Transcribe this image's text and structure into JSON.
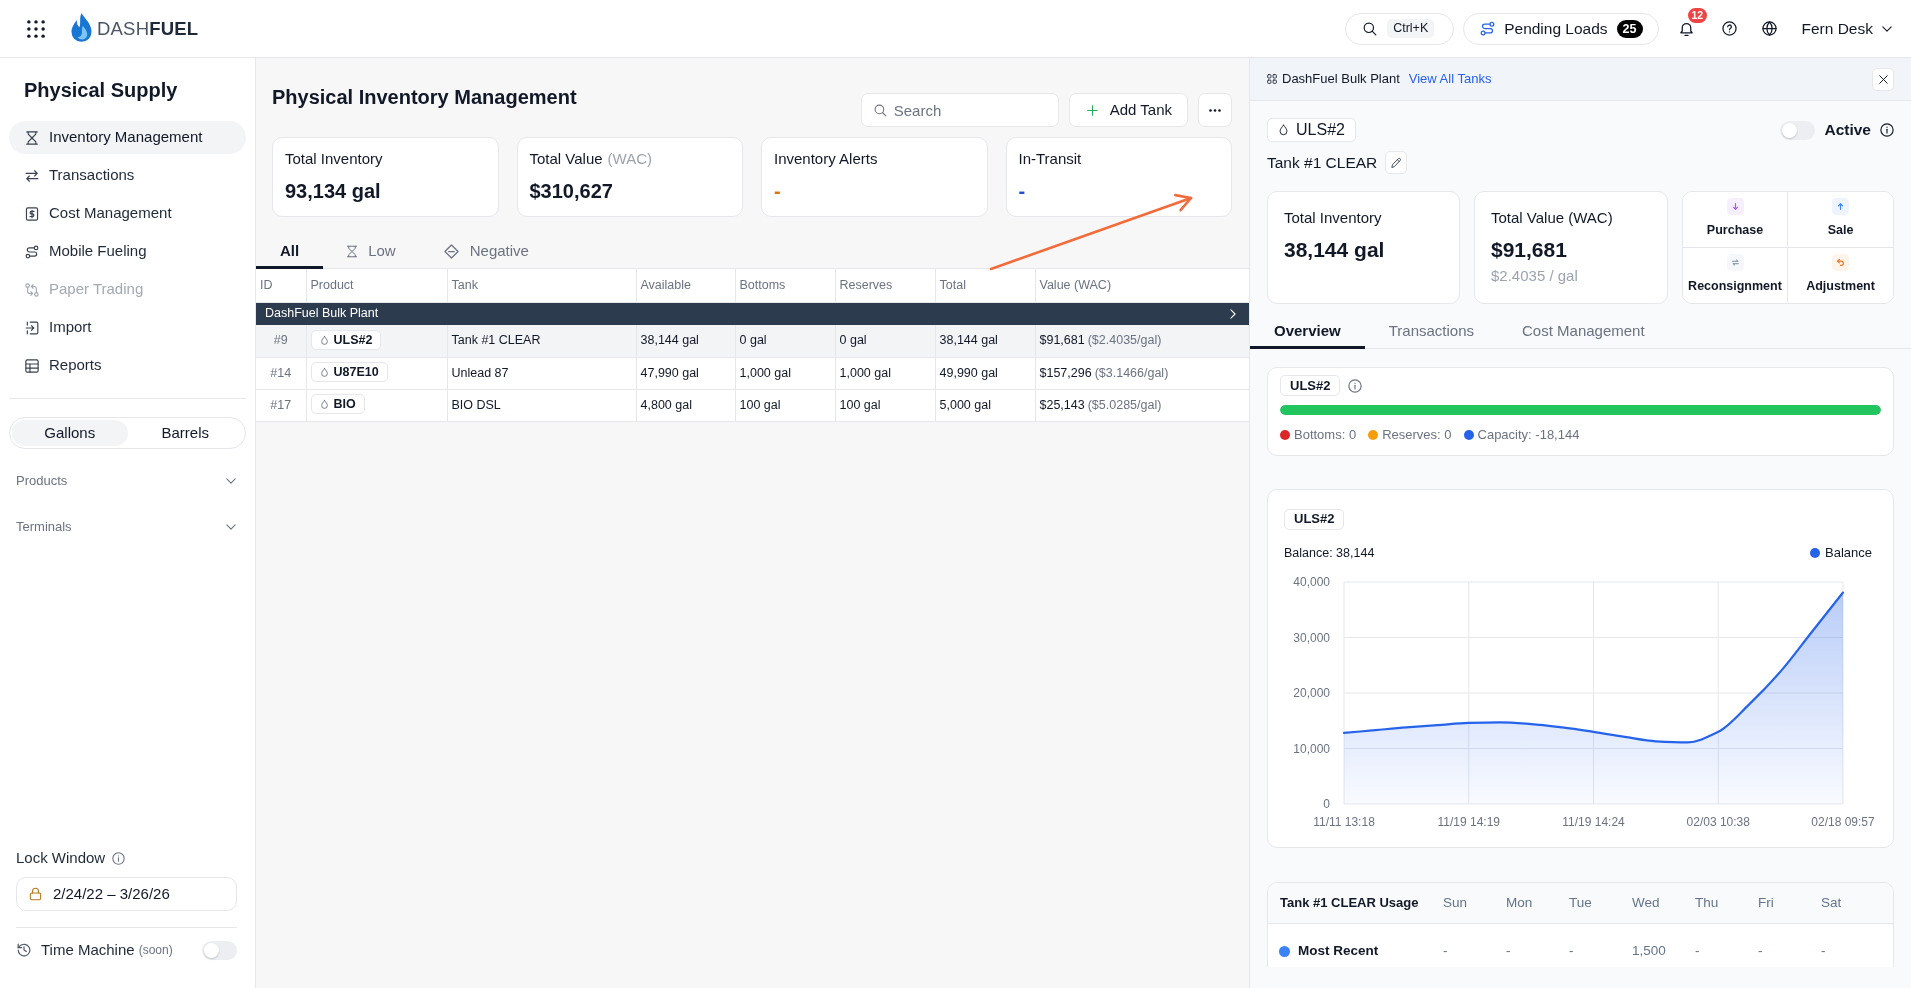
{
  "topbar": {
    "logo": "DASH**FUEL**",
    "search_shortcut": "Ctrl+K",
    "pending_loads": {
      "label": "Pending Loads",
      "count": "25"
    },
    "notifications": {
      "count": "12"
    },
    "user": "Fern Desk"
  },
  "sidebar": {
    "title": "Physical Supply",
    "items": [
      {
        "label": "Inventory Management",
        "selected": true,
        "disabled": false
      },
      {
        "label": "Transactions",
        "selected": false,
        "disabled": false
      },
      {
        "label": "Cost Management",
        "selected": false,
        "disabled": false
      },
      {
        "label": "Mobile Fueling",
        "selected": false,
        "disabled": false
      },
      {
        "label": "Paper Trading",
        "selected": false,
        "disabled": true
      },
      {
        "label": "Import",
        "selected": false,
        "disabled": false
      },
      {
        "label": "Reports",
        "selected": false,
        "disabled": false
      }
    ],
    "units": [
      {
        "label": "Gallons",
        "selected": true
      },
      {
        "label": "Barrels",
        "selected": false
      }
    ],
    "filters": [
      {
        "label": "Products",
        "expanded": false
      },
      {
        "label": "Terminals",
        "expanded": false
      }
    ],
    "lock_window": {
      "label": "Lock Window",
      "value": "2/24/22 – 3/26/26"
    },
    "time_machine": {
      "label": "Time Machine",
      "note": "(soon)",
      "on": false
    }
  },
  "main": {
    "title": "Physical Inventory Management",
    "search": {
      "placeholder": "Search"
    },
    "add_button": "Add Tank",
    "stats": [
      {
        "label": "Total Inventory",
        "value": "93,134 gal",
        "color": "#111827"
      },
      {
        "label": "Total Value",
        "note": "(WAC)",
        "value": "$310,627",
        "color": "#111827"
      },
      {
        "label": "Inventory Alerts",
        "value": "-",
        "color": "#d97706"
      },
      {
        "label": "In-Transit",
        "value": "-",
        "color": "#1d4ed8"
      }
    ],
    "tabs": [
      {
        "label": "All",
        "selected": true
      },
      {
        "label": "Low",
        "selected": false
      },
      {
        "label": "Negative",
        "selected": false
      }
    ],
    "table": {
      "columns": [
        "ID",
        "Product",
        "Tank",
        "Available",
        "Bottoms",
        "Reserves",
        "Total",
        "Value (WAC)"
      ],
      "groups": [
        {
          "name": "DashFuel Bulk Plant",
          "rows": [
            {
              "id": "#9",
              "product": "ULS#2",
              "tank": "Tank #1 CLEAR",
              "available": "38,144 gal",
              "bottoms": "0 gal",
              "reserves": "0 gal",
              "total": "38,144 gal",
              "value": "$91,681",
              "value_rate": "($2.4035/gal)",
              "selected": true
            },
            {
              "id": "#14",
              "product": "U87E10",
              "tank": "Unlead 87",
              "available": "47,990 gal",
              "bottoms": "1,000 gal",
              "reserves": "1,000 gal",
              "total": "49,990 gal",
              "value": "$157,296",
              "value_rate": "($3.1466/gal)",
              "selected": false
            },
            {
              "id": "#17",
              "product": "BIO",
              "tank": "BIO DSL",
              "available": "4,800 gal",
              "bottoms": "100 gal",
              "reserves": "100 gal",
              "total": "5,000 gal",
              "value": "$25,143",
              "value_rate": "($5.0285/gal)",
              "selected": false
            }
          ]
        }
      ]
    }
  },
  "detail": {
    "header": {
      "title": "DashFuel Bulk Plant",
      "link": "View All Tanks"
    },
    "product": "ULS#2",
    "active": {
      "label": "Active",
      "on": false
    },
    "tank": "Tank #1 CLEAR",
    "stats": [
      {
        "label": "Total Inventory",
        "value": "38,144 gal"
      },
      {
        "label": "Total Value (WAC)",
        "value": "$91,681",
        "sub": "$2.4035 / gal"
      }
    ],
    "actions": [
      "Purchase",
      "Sale",
      "Reconsignment",
      "Adjustment"
    ],
    "tabs": [
      {
        "label": "Overview",
        "selected": true
      },
      {
        "label": "Transactions",
        "selected": false
      },
      {
        "label": "Cost Management",
        "selected": false
      }
    ],
    "capacity": {
      "product": "ULS#2",
      "level": 1,
      "legend": [
        {
          "label": "Bottoms: 0",
          "color": "#dc2626"
        },
        {
          "label": "Reserves: 0",
          "color": "#f59e0b"
        },
        {
          "label": "Capacity: -18,144",
          "color": "#2563eb"
        }
      ]
    },
    "balance": {
      "product": "ULS#2",
      "summary": "Balance: 38,144",
      "chart_data": {
        "type": "area",
        "categories": [
          "11/11 13:18",
          null,
          null,
          null,
          "11/19 14:19",
          null,
          null,
          null,
          "11/19 14:24",
          null,
          null,
          null,
          "02/03 10:38",
          null,
          null,
          null,
          "02/18 09:57"
        ],
        "series": [
          {
            "name": "Balance",
            "color": "#2563eb",
            "values": [
              12800,
              13300,
              13800,
              14200,
              14600,
              14700,
              14400,
              13800,
              13000,
              12100,
              11300,
              11100,
              13000,
              18000,
              23900,
              31000,
              38100
            ]
          }
        ],
        "ylim": [
          0,
          40000
        ],
        "yticks": [
          {
            "value": 0,
            "label": "0"
          },
          {
            "value": 10000,
            "label": "10,000"
          },
          {
            "value": 20000,
            "label": "20,000"
          },
          {
            "value": 30000,
            "label": "30,000"
          },
          {
            "value": 40000,
            "label": "40,000"
          }
        ],
        "grid": true
      }
    },
    "usage": {
      "title": "Tank #1 CLEAR Usage",
      "days": [
        "Sun",
        "Mon",
        "Tue",
        "Wed",
        "Thu",
        "Fri",
        "Sat"
      ],
      "rows": [
        {
          "label": "Most Recent",
          "color": "#3b82f6",
          "values": [
            "-",
            "-",
            "-",
            "1,500",
            "-",
            "-",
            "-"
          ]
        }
      ]
    }
  }
}
